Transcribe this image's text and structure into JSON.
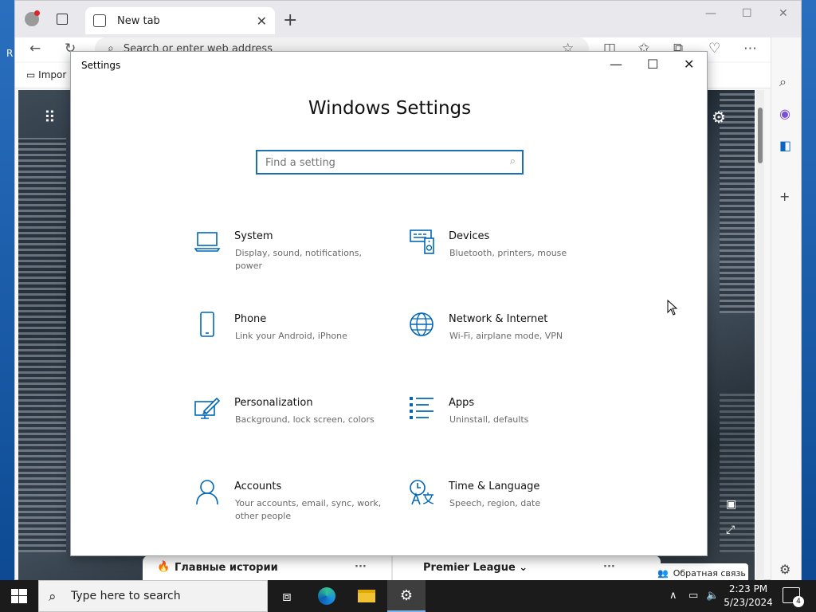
{
  "desktop": {
    "edge_letter": "R"
  },
  "browser": {
    "tab": {
      "title": "New tab",
      "close": "✕"
    },
    "new_tab": "+",
    "window_controls": {
      "minimize": "—",
      "maximize": "☐",
      "close": "✕"
    },
    "address_placeholder": "Search or enter web address",
    "favorites_item": "Impor",
    "news": {
      "top_stories": "Главные истории",
      "premier_league": "Premier League",
      "more": "···"
    },
    "feedback": "Обратная связь"
  },
  "settings": {
    "window_title": "Settings",
    "heading": "Windows Settings",
    "search_placeholder": "Find a setting",
    "categories": [
      {
        "title": "System",
        "desc": "Display, sound, notifications, power",
        "icon": "laptop-icon"
      },
      {
        "title": "Devices",
        "desc": "Bluetooth, printers, mouse",
        "icon": "devices-icon"
      },
      {
        "title": "Phone",
        "desc": "Link your Android, iPhone",
        "icon": "phone-icon"
      },
      {
        "title": "Network & Internet",
        "desc": "Wi-Fi, airplane mode, VPN",
        "icon": "globe-icon"
      },
      {
        "title": "Personalization",
        "desc": "Background, lock screen, colors",
        "icon": "paint-icon"
      },
      {
        "title": "Apps",
        "desc": "Uninstall, defaults",
        "icon": "apps-list-icon"
      },
      {
        "title": "Accounts",
        "desc": "Your accounts, email, sync, work, other people",
        "icon": "person-icon"
      },
      {
        "title": "Time & Language",
        "desc": "Speech, region, date",
        "icon": "time-language-icon"
      }
    ]
  },
  "taskbar": {
    "search_text": "Type here to search",
    "time": "2:23 PM",
    "date": "5/23/2024",
    "notification_count": "4"
  },
  "colors": {
    "accent": "#0067b8",
    "taskbar": "#1b1b1b"
  }
}
